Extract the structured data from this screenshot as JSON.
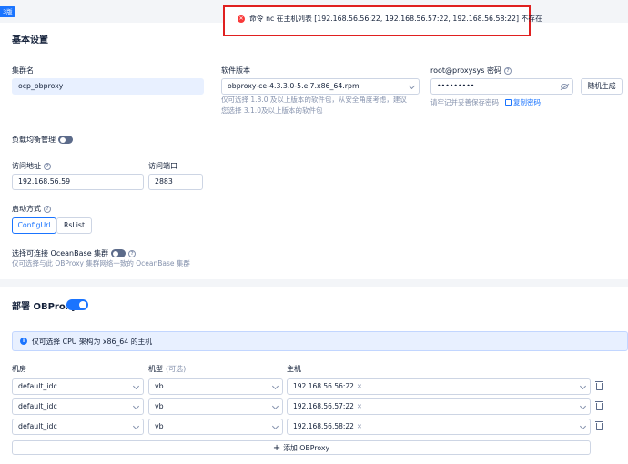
{
  "corner_badge": "3版",
  "toast": {
    "message": "命令 nc 在主机列表 [192.168.56.56:22, 192.168.56.57:22, 192.168.56.58:22] 不存在"
  },
  "basic": {
    "title": "基本设置",
    "cluster_name_label": "集群名",
    "cluster_name_value": "ocp_obproxy",
    "version_label": "软件版本",
    "version_value": "obproxy-ce-4.3.3.0-5.el7.x86_64.rpm",
    "version_hint_1": "仅可选择 1.8.0 及以上版本的软件包，从安全角度考虑，建议",
    "version_hint_2": "您选择 3.1.0及以上版本的软件包",
    "password_label": "root@proxysys 密码",
    "password_value": "•••••••••",
    "random_button": "随机生成",
    "password_hint": "请牢记并妥善保存密码",
    "copy_password": "复制密码",
    "lb_label": "负载均衡管理",
    "access_addr_label": "访问地址",
    "access_addr_value": "192.168.56.59",
    "access_port_label": "访问端口",
    "access_port_value": "2883",
    "start_mode_label": "启动方式",
    "start_modes": [
      "ConfigUrl",
      "RsList"
    ],
    "connect_label": "选择可连接 OceanBase 集群",
    "connect_hint": "仅可选择与此 OBProxy 集群网络一致的 OceanBase 集群"
  },
  "deploy": {
    "title": "部署 OBProxy",
    "info": "仅可选择 CPU 架构为 x86_64 的主机",
    "col_idc": "机房",
    "col_model": "机型",
    "col_model_optional": "(可选)",
    "col_host": "主机",
    "rows": [
      {
        "idc": "default_idc",
        "model": "vb",
        "host": "192.168.56.56:22"
      },
      {
        "idc": "default_idc",
        "model": "vb",
        "host": "192.168.56.57:22"
      },
      {
        "idc": "default_idc",
        "model": "vb",
        "host": "192.168.56.58:22"
      }
    ],
    "add_label": "添加 OBProxy"
  }
}
